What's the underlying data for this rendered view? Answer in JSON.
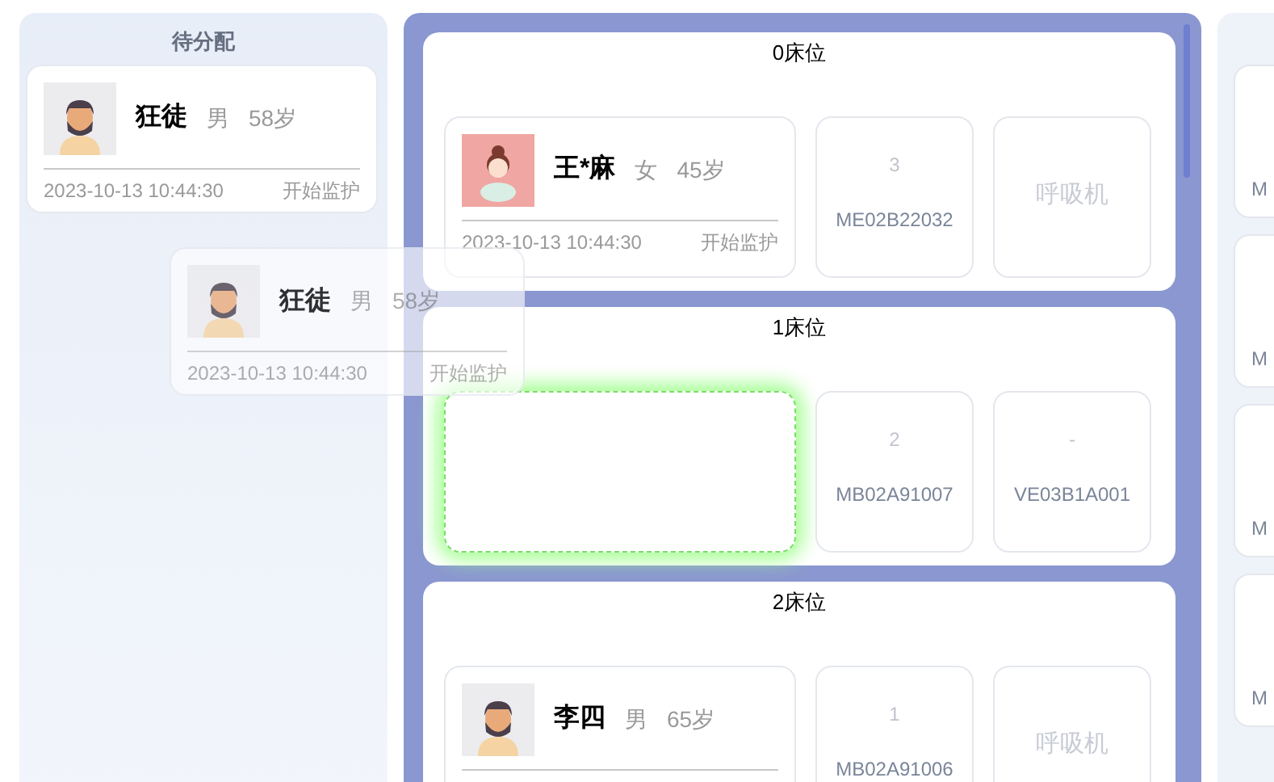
{
  "pending": {
    "title": "待分配",
    "patients": [
      {
        "name": "狂徒",
        "gender": "男",
        "age": "58岁",
        "time": "2023-10-13 10:44:30",
        "action": "开始监护",
        "avatar": {
          "kind": "male"
        }
      }
    ]
  },
  "drag_ghost": {
    "name": "狂徒",
    "gender": "男",
    "age": "58岁",
    "time": "2023-10-13 10:44:30",
    "action": "开始监护",
    "avatar": {
      "kind": "male"
    }
  },
  "beds": [
    {
      "title": "0床位",
      "drop_target": false,
      "patient": {
        "name": "王*麻",
        "gender": "女",
        "age": "45岁",
        "time": "2023-10-13 10:44:30",
        "action": "开始监护",
        "avatar": {
          "kind": "female"
        }
      },
      "devices": [
        {
          "kind": "device",
          "number": "3",
          "code": "ME02B22032"
        },
        {
          "kind": "empty",
          "label": "呼吸机"
        }
      ]
    },
    {
      "title": "1床位",
      "drop_target": true,
      "devices": [
        {
          "kind": "device",
          "number": "2",
          "code": "MB02A91007"
        },
        {
          "kind": "device",
          "number": "-",
          "code": "VE03B1A001"
        }
      ]
    },
    {
      "title": "2床位",
      "drop_target": false,
      "patient": {
        "name": "李四",
        "gender": "男",
        "age": "65岁",
        "avatar": {
          "kind": "male"
        }
      },
      "devices": [
        {
          "kind": "device",
          "number": "1",
          "code": "MB02A91006"
        },
        {
          "kind": "empty",
          "label": "呼吸机"
        }
      ]
    }
  ],
  "right_panel": {
    "cards": [
      {
        "code": "M"
      },
      {
        "code": "M"
      },
      {
        "code": "M"
      },
      {
        "code": "M"
      }
    ]
  }
}
